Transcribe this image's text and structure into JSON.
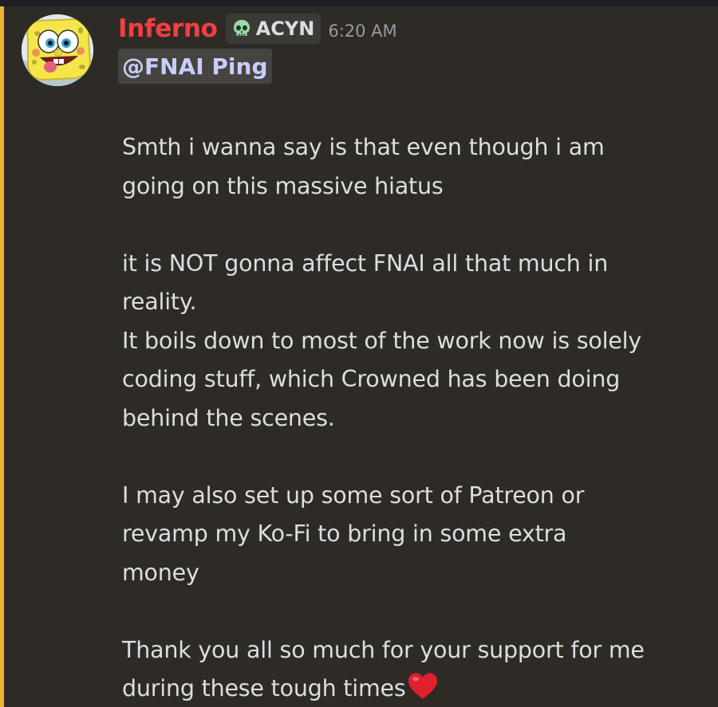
{
  "message": {
    "author": "Inferno",
    "author_color": "#f23f43",
    "avatar": "spongebob-avatar",
    "role_tag": {
      "icon": "skull-icon",
      "label": "ACYN"
    },
    "timestamp": "6:20 AM",
    "mention": "@FNAI Ping",
    "lines": {
      "l1": "Smth i wanna say is that even though i am",
      "l2": "going on this massive hiatus",
      "l3": "it is NOT gonna affect FNAI all that much in",
      "l4": "reality.",
      "l5": "It boils down to most of the work now is solely",
      "l6": "coding stuff, which Crowned has been doing",
      "l7": "behind the scenes.",
      "l8": "I may also set up some sort of Patreon or",
      "l9": "revamp my Ko-Fi to bring in some extra",
      "l10": "money",
      "l11": "Thank you all so much for your support for me",
      "l12": "during these tough times"
    },
    "emoji": "red-heart-icon",
    "highlight_color": "#f0b232"
  }
}
